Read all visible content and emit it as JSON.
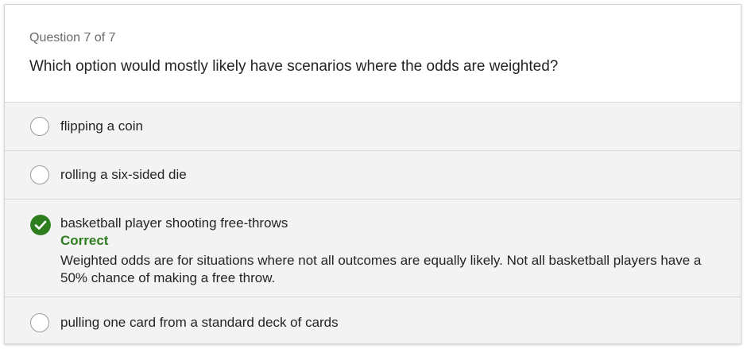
{
  "question": {
    "counter": "Question 7 of 7",
    "text": "Which option would mostly likely have scenarios where the odds are weighted?"
  },
  "options": [
    {
      "label": "flipping a coin",
      "selected": false
    },
    {
      "label": "rolling a six-sided die",
      "selected": false
    },
    {
      "label": "basketball player shooting free-throws",
      "selected": true,
      "status": "Correct",
      "explanation": "Weighted odds are for situations where not all outcomes are equally likely. Not all basketball players have a 50% chance of making a free throw."
    },
    {
      "label": "pulling one card from a standard deck of cards",
      "selected": false
    }
  ],
  "colors": {
    "correct_green": "#2e7d1e",
    "option_bg": "#f3f3f3",
    "divider": "#d9d9d9"
  },
  "icons": {
    "selected_option": "checkmark-circle-icon",
    "unselected_option": "radio-circle-icon"
  }
}
